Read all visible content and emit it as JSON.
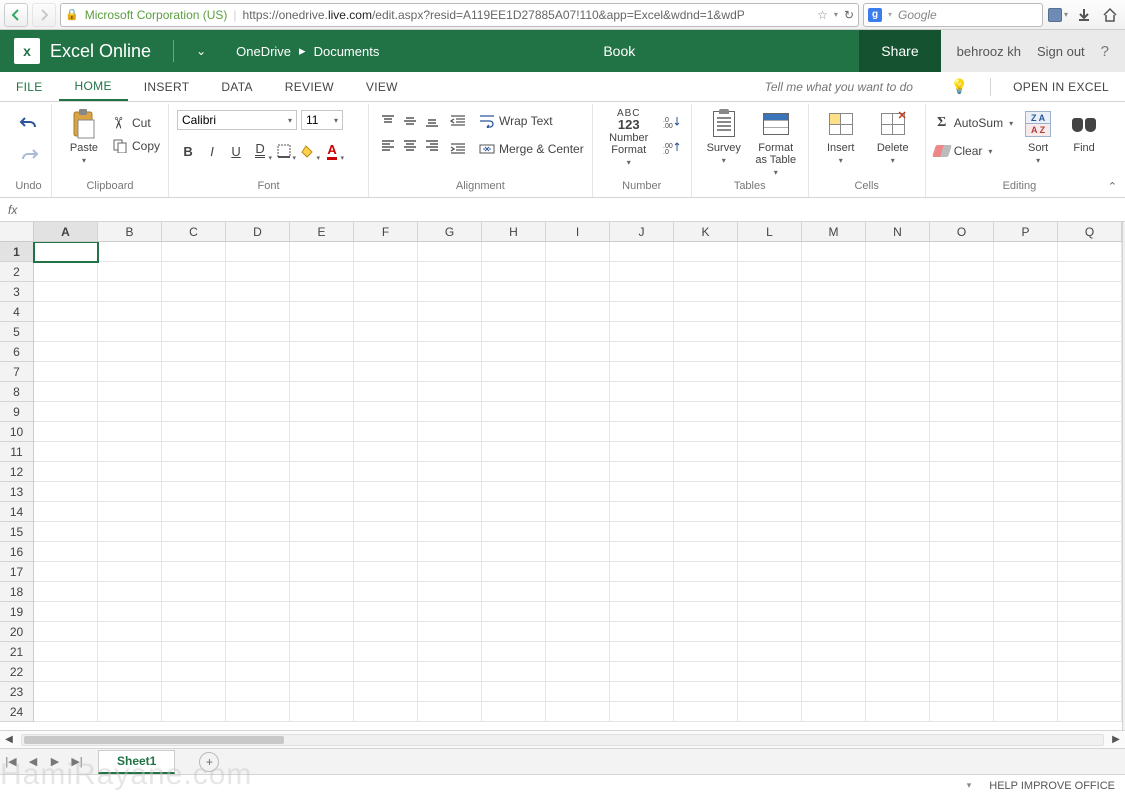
{
  "browser": {
    "identity": "Microsoft Corporation (US)",
    "url_prefix": "https://onedrive.",
    "url_domain": "live.com",
    "url_suffix": "/edit.aspx?resid=A119EE1D27885A07!110&app=Excel&wdnd=1&wdP",
    "search_placeholder": "Google"
  },
  "title": {
    "app": "Excel Online",
    "crumb1": "OneDrive",
    "crumb2": "Documents",
    "doc": "Book",
    "share": "Share",
    "user": "behrooz kh",
    "signout": "Sign out"
  },
  "tabs": {
    "file": "FILE",
    "home": "HOME",
    "insert": "INSERT",
    "data": "DATA",
    "review": "REVIEW",
    "view": "VIEW",
    "tell": "Tell me what you want to do",
    "open": "OPEN IN EXCEL"
  },
  "ribbon": {
    "undo": "Undo",
    "paste": "Paste",
    "cut": "Cut",
    "copy": "Copy",
    "clipboard": "Clipboard",
    "font_name": "Calibri",
    "font_size": "11",
    "font": "Font",
    "wrap": "Wrap Text",
    "merge": "Merge & Center",
    "alignment": "Alignment",
    "numfmt": "Number Format",
    "number": "Number",
    "survey": "Survey",
    "fmt_table": "Format as Table",
    "tables": "Tables",
    "insert": "Insert",
    "delete": "Delete",
    "cells": "Cells",
    "autosum": "AutoSum",
    "clear": "Clear",
    "sort": "Sort",
    "find": "Find",
    "editing": "Editing",
    "num_abc": "ABC",
    "num_123": "123"
  },
  "grid": {
    "cols": [
      "A",
      "B",
      "C",
      "D",
      "E",
      "F",
      "G",
      "H",
      "I",
      "J",
      "K",
      "L",
      "M",
      "N",
      "O",
      "P",
      "Q"
    ],
    "rows": [
      "1",
      "2",
      "3",
      "4",
      "5",
      "6",
      "7",
      "8",
      "9",
      "10",
      "11",
      "12",
      "13",
      "14",
      "15",
      "16",
      "17",
      "18",
      "19",
      "20",
      "21",
      "22",
      "23",
      "24"
    ],
    "active": "A1"
  },
  "sheet": {
    "name": "Sheet1"
  },
  "status": {
    "help": "HELP IMPROVE OFFICE"
  },
  "watermark": "HamiRayane.com"
}
